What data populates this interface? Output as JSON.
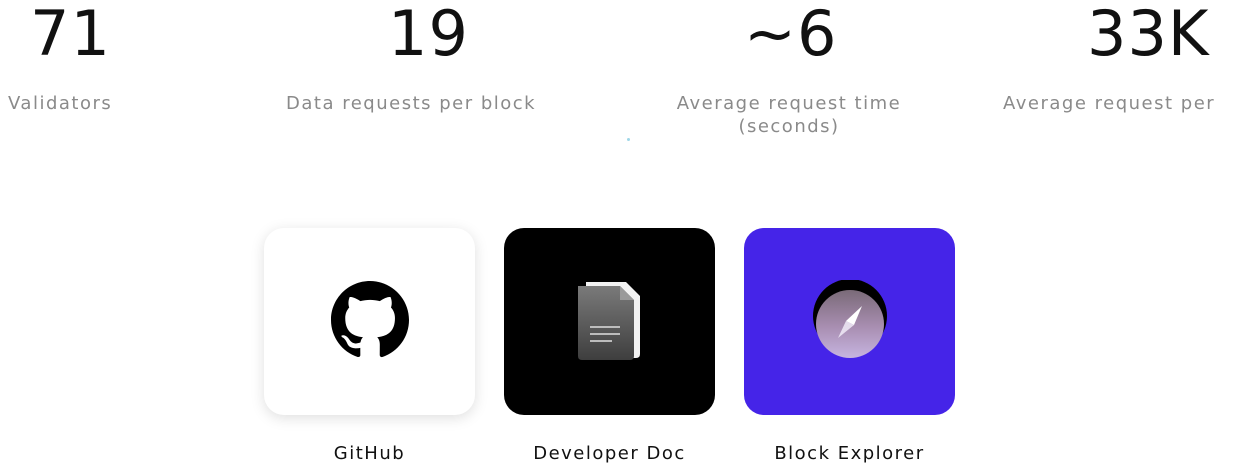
{
  "stats": [
    {
      "value": "71",
      "label_lines": [
        "Validators"
      ]
    },
    {
      "value": "19",
      "label_lines": [
        "Data requests per block"
      ]
    },
    {
      "value": "~6",
      "label_lines": [
        "Average request time",
        "(seconds)"
      ]
    },
    {
      "value": "33K",
      "label_lines": [
        "Average request per"
      ]
    }
  ],
  "links": [
    {
      "label": "GitHub",
      "icon": "github-icon",
      "bg": "#ffffff"
    },
    {
      "label": "Developer Doc",
      "icon": "document-icon",
      "bg": "#000000"
    },
    {
      "label": "Block Explorer",
      "icon": "compass-icon",
      "bg": "#4524e8"
    }
  ]
}
